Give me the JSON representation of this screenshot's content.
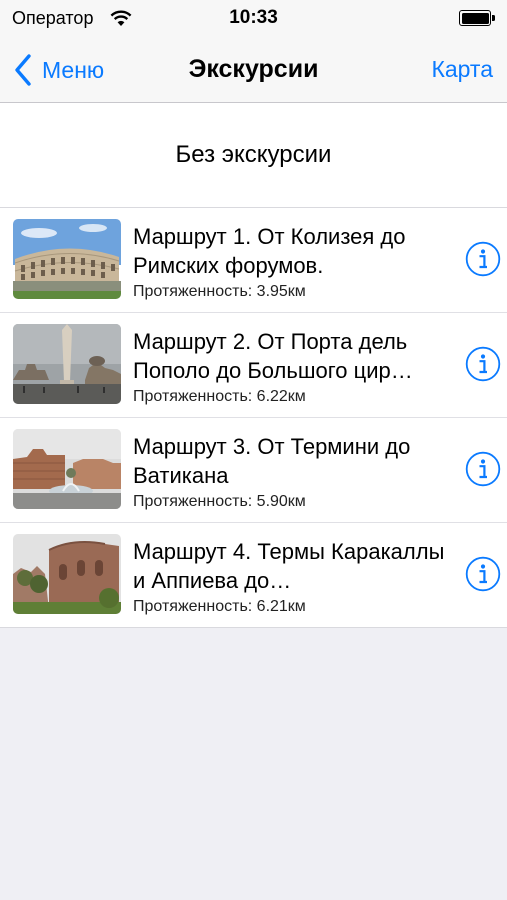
{
  "status_bar": {
    "carrier": "Оператор",
    "time": "10:33"
  },
  "nav": {
    "back_label": "Меню",
    "title": "Экскурсии",
    "right_label": "Карта"
  },
  "no_excursion_label": "Без экскурсии",
  "routes": [
    {
      "title": "Маршрут 1. От Колизея до Римских форумов.",
      "length": "Протяженность: 3.95км",
      "image": "colosseum"
    },
    {
      "title": "Маршрут 2. От Порта дель Пополо до Большого цир…",
      "length": "Протяженность: 6.22км",
      "image": "piazza-del-popolo-obelisk"
    },
    {
      "title": "Маршрут 3. От Термини до Ватикана",
      "length": "Протяженность: 5.90км",
      "image": "termini-fountain"
    },
    {
      "title": "Маршрут 4. Термы Каракаллы и Аппиева до…",
      "length": "Протяженность: 6.21км",
      "image": "baths-of-caracalla"
    }
  ],
  "colors": {
    "accent": "#0a7aff",
    "background": "#efeff4",
    "bar": "#f7f7f7"
  },
  "icons": {
    "back": "chevron-left-icon",
    "info": "info-circle-icon",
    "wifi": "wifi-icon",
    "battery": "battery-icon"
  }
}
